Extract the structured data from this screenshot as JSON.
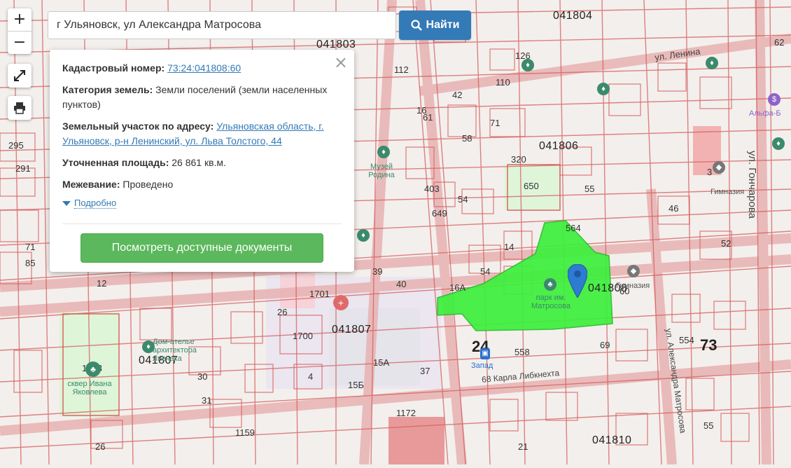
{
  "search": {
    "value": "г Ульяновск, ул Александра Матросова",
    "button_label": "Найти"
  },
  "controls": {
    "zoom_in": "+",
    "zoom_out": "−"
  },
  "popup": {
    "cadastral_label": "Кадастровый номер:",
    "cadastral_value": "73:24:041808:60",
    "category_label": "Категория земель:",
    "category_value": "Земли поселений (земли населенных пунктов)",
    "address_label": "Земельный участок по адресу:",
    "address_value": "Ульяновская область, г. Ульяновск, р-н Ленинский, ул. Льва Толстого, 44",
    "area_label": "Уточненная площадь:",
    "area_value": "26 861 кв.м.",
    "survey_label": "Межевание:",
    "survey_value": "Проведено",
    "more_label": "Подробно",
    "documents_button": "Посмотреть доступные документы",
    "close": "×"
  },
  "map": {
    "quarters": [
      "041804",
      "041803",
      "041806",
      "041807",
      "041807",
      "041808",
      "041810"
    ],
    "big_labels": [
      "73",
      "24"
    ],
    "streets": [
      "ул. Ленина",
      "ул. Гончарова",
      "68 Карла Либкнехта",
      "ул. Александра Матросова"
    ],
    "pois": [
      {
        "label": "парк им. Матросова",
        "color": "#3b8a6c"
      },
      {
        "label": "сквер Ивана Яковлева",
        "color": "#3b8a6c"
      },
      {
        "label": "Гимназия",
        "color": "#555555"
      },
      {
        "label": "Запад",
        "color": "#2a6fd1"
      },
      {
        "label": "Дом-ателье архитектора Ливчака",
        "color": "#3b8a6c"
      },
      {
        "label": "Музей Родина",
        "color": "#3b8a6c"
      },
      {
        "label": "Гимназия",
        "color": "#555555"
      },
      {
        "label": "Альфа-Б",
        "color": "#8e63c9"
      }
    ],
    "parcel_numbers": [
      "112",
      "110",
      "126",
      "42",
      "71",
      "61",
      "58",
      "320",
      "650",
      "403",
      "649",
      "54",
      "55",
      "564",
      "14",
      "16",
      "54",
      "1701",
      "26",
      "1700",
      "15А",
      "15Б",
      "4",
      "30",
      "31",
      "37",
      "558",
      "69",
      "554",
      "62",
      "295",
      "291",
      "71",
      "85",
      "12",
      "1573",
      "26",
      "1159",
      "1172",
      "21",
      "40",
      "46",
      "52",
      "3",
      "39",
      "60",
      "55",
      "16А"
    ],
    "colors": {
      "parcel_line": "#d98a8a",
      "road_line": "#e2a6a6",
      "selected_parcel": "#3cf03c",
      "pin": "#2f7bd1"
    }
  }
}
